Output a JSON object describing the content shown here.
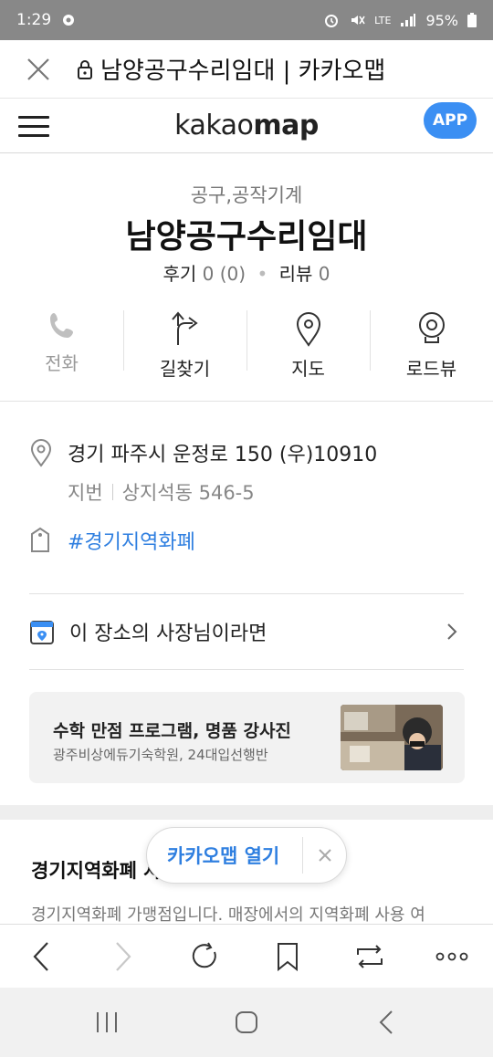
{
  "status_bar": {
    "time": "1:29",
    "network": "LTE",
    "battery": "95%"
  },
  "browser_tab": {
    "title": "남양공구수리임대 | 카카오맵"
  },
  "kakao_header": {
    "logo_light": "kakao",
    "logo_bold": "map",
    "app_button": "APP"
  },
  "place": {
    "category": "공구,공작기계",
    "name": "남양공구수리임대",
    "review_label": "후기",
    "review_value": "0 (0)",
    "comment_label": "리뷰",
    "comment_value": "0"
  },
  "actions": [
    {
      "label": "전화",
      "icon": "phone-icon"
    },
    {
      "label": "길찾기",
      "icon": "directions-icon"
    },
    {
      "label": "지도",
      "icon": "map-pin-icon"
    },
    {
      "label": "로드뷰",
      "icon": "roadview-icon"
    }
  ],
  "info": {
    "address": "경기 파주시 운정로 150 (우)10910",
    "jibun_label": "지번",
    "jibun_value": "상지석동 546-5",
    "tag": "#경기지역화폐"
  },
  "owner": {
    "label": "이 장소의 사장님이라면"
  },
  "ad": {
    "title": "수학 만점 프로그램, 명품 강사진",
    "subtitle": "광주비상에듀기숙학원, 24대입선행반"
  },
  "section": {
    "heading": "경기지역화폐 사용처 안내",
    "text": "경기지역화폐 가맹점입니다. 매장에서의 지역화폐 사용 여"
  },
  "float": {
    "open_label": "카카오맵 열기"
  },
  "colors": {
    "accent": "#2f7fe0",
    "app_button": "#3b8ff3",
    "status_bar": "#888888"
  }
}
